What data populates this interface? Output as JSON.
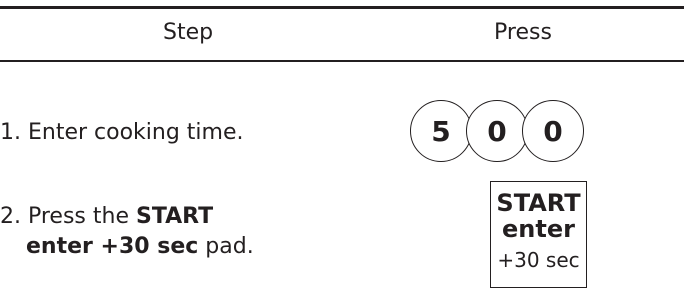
{
  "table": {
    "headers": {
      "step": "Step",
      "press": "Press"
    },
    "rows": [
      {
        "step_text": "1. Enter cooking time.",
        "keys": [
          "5",
          "0",
          "0"
        ]
      },
      {
        "step_prefix": "2. Press the ",
        "step_bold_1": "START",
        "step_bold_2": "enter +30 sec",
        "step_suffix": " pad.",
        "pad": {
          "line1": "START",
          "line2": "enter",
          "line3": "+30 sec"
        }
      }
    ]
  }
}
